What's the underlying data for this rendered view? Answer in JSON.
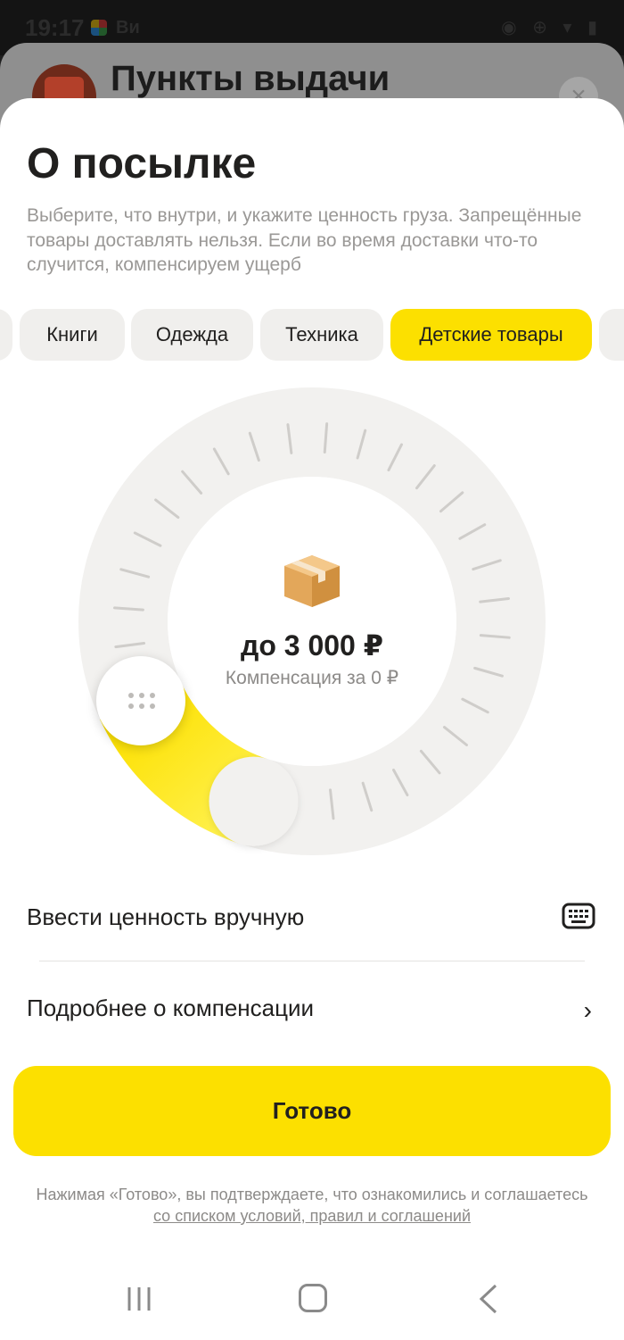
{
  "status_bar": {
    "time": "19:17",
    "app_label": "Ви"
  },
  "background_screen": {
    "title": "Пункты выдачи"
  },
  "sheet": {
    "title": "О посылке",
    "subtitle": "Выберите, что внутри, и укажите ценность груза. Запрещённые товары доставлять нельзя. Если во время доставки что-то случится, компенсируем ущерб",
    "categories": [
      {
        "label": "Книги",
        "selected": false
      },
      {
        "label": "Одежда",
        "selected": false
      },
      {
        "label": "Техника",
        "selected": false
      },
      {
        "label": "Детские товары",
        "selected": true
      }
    ],
    "dial": {
      "amount": "до 3 000 ₽",
      "compensation": "Компенсация за 0 ₽",
      "level_fraction": 0.12
    },
    "manual_value_label": "Ввести ценность вручную",
    "details_label": "Подробнее о компенсации",
    "done_label": "Готово",
    "legal_text": "Нажимая «Готово», вы подтверждаете, что ознакомились и соглашаетесь ",
    "legal_link": "со списком условий, правил и соглашений"
  },
  "colors": {
    "accent": "#fce000",
    "text": "#21201f",
    "secondary_text": "#9a9896"
  }
}
